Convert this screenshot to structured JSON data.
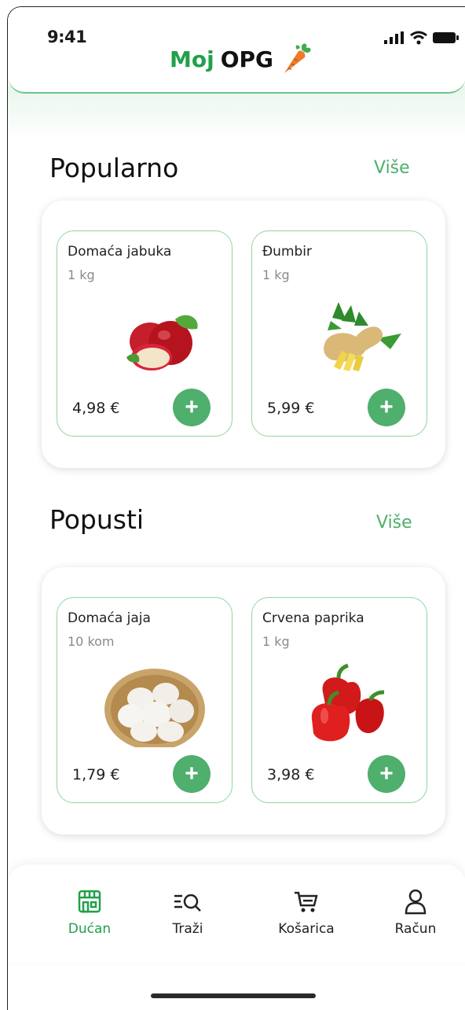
{
  "status": {
    "time": "9:41"
  },
  "brand": {
    "moj": "Moj",
    "opg": "OPG",
    "accent": "#21a04a"
  },
  "sections": {
    "popular": {
      "title": "Popularno",
      "more": "Više",
      "products": [
        {
          "name": "Domaća jabuka",
          "unit": "1 kg",
          "price": "4,98 €",
          "add": "+",
          "image": "apple-image"
        },
        {
          "name": "Đumbir",
          "unit": "1 kg",
          "price": "5,99 €",
          "add": "+",
          "image": "ginger-image"
        }
      ]
    },
    "discounts": {
      "title": "Popusti",
      "more": "Više",
      "products": [
        {
          "name": "Domaća jaja",
          "unit": "10 kom",
          "price": "1,79 €",
          "add": "+",
          "image": "eggs-image"
        },
        {
          "name": "Crvena paprika",
          "unit": "1 kg",
          "price": "3,98 €",
          "add": "+",
          "image": "pepper-image"
        }
      ]
    }
  },
  "tabbar": {
    "items": [
      {
        "label": "Dućan",
        "icon": "store-icon",
        "active": true
      },
      {
        "label": "Traži",
        "icon": "search-icon",
        "active": false
      },
      {
        "label": "Košarica",
        "icon": "cart-icon",
        "active": false
      },
      {
        "label": "Račun",
        "icon": "user-icon",
        "active": false
      }
    ]
  },
  "colors": {
    "primary": "#4faf6d",
    "border": "#8fd6a4",
    "active_tab": "#21a04a"
  }
}
